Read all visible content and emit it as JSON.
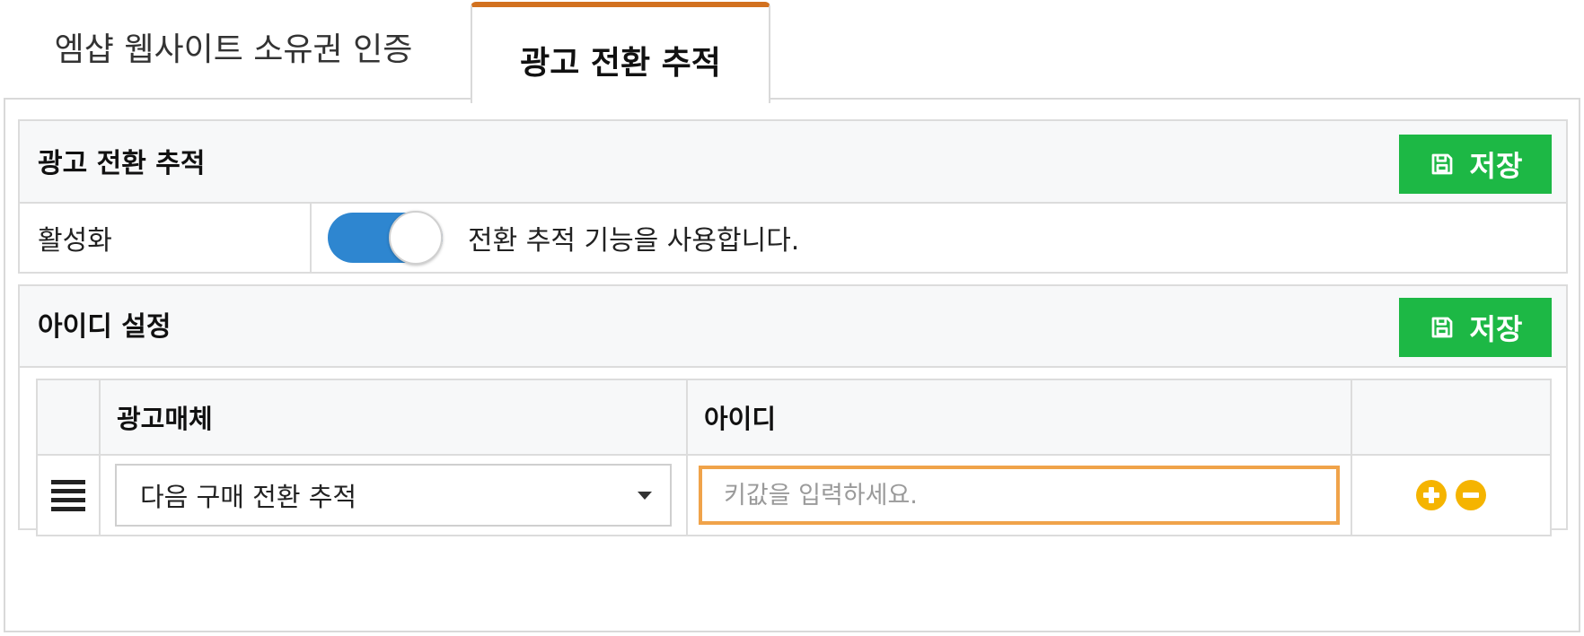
{
  "tabs": [
    {
      "label": "엠샵 웹사이트 소유권 인증",
      "active": false
    },
    {
      "label": "광고 전환 추적",
      "active": true
    }
  ],
  "conversion_card": {
    "title": "광고 전환 추적",
    "save_label": "저장",
    "save_icon": "floppy-disk-icon",
    "activate_label": "활성화",
    "toggle_on": true,
    "toggle_description": "전환 추적 기능을 사용합니다."
  },
  "id_card": {
    "title": "아이디 설정",
    "save_label": "저장",
    "save_icon": "floppy-disk-icon",
    "table": {
      "headers": [
        "",
        "광고매체",
        "아이디",
        ""
      ],
      "rows": [
        {
          "drag_icon": "drag-handle-icon",
          "media": "다음 구매 전환 추적",
          "id_value": "",
          "id_placeholder": "키값을 입력하세요.",
          "actions": [
            "plus-circle-icon",
            "minus-circle-icon"
          ]
        }
      ]
    }
  },
  "colors": {
    "active_tab_accent": "#d2711f",
    "save_button": "#1db845",
    "toggle_on": "#2e86d0",
    "input_focus_border": "#f0a34a",
    "action_icons": "#f5b400"
  }
}
